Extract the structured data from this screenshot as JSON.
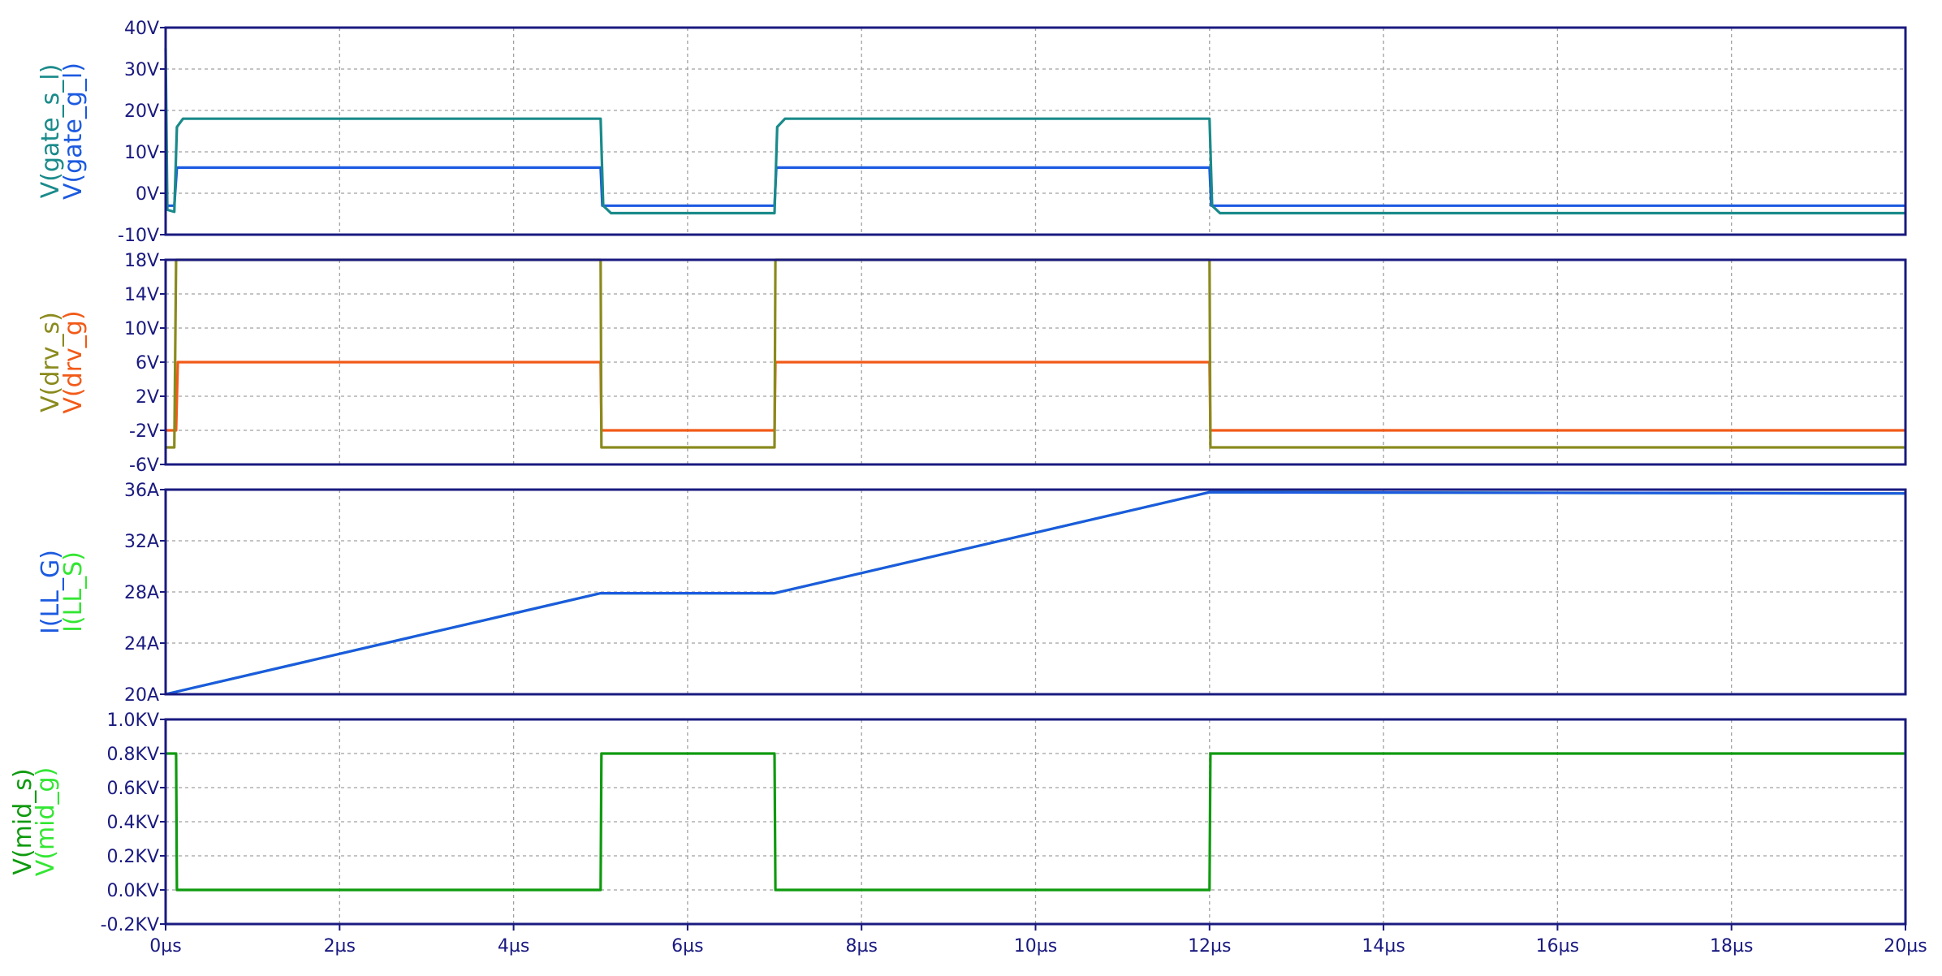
{
  "chart_data": [
    {
      "type": "line",
      "panel": "gate",
      "ylim": [
        -10,
        40
      ],
      "yticks": [
        {
          "value": 40,
          "label": "40V"
        },
        {
          "value": 30,
          "label": "30V"
        },
        {
          "value": 20,
          "label": "20V"
        },
        {
          "value": 10,
          "label": "10V"
        },
        {
          "value": 0,
          "label": "0V"
        },
        {
          "value": -10,
          "label": "-10V"
        }
      ],
      "grid": true,
      "series": [
        {
          "name": "V(gate_s_l)",
          "color": "#1a8a8a",
          "points": [
            [
              0,
              35
            ],
            [
              0.02,
              -4
            ],
            [
              0.1,
              -4.5
            ],
            [
              0.13,
              16
            ],
            [
              0.2,
              18
            ],
            [
              5.0,
              18
            ],
            [
              5.03,
              -3
            ],
            [
              5.12,
              -4.8
            ],
            [
              7.0,
              -4.8
            ],
            [
              7.03,
              16
            ],
            [
              7.12,
              18
            ],
            [
              12.0,
              18
            ],
            [
              12.03,
              -3
            ],
            [
              12.12,
              -4.8
            ],
            [
              20,
              -4.8
            ]
          ]
        },
        {
          "name": "V(gate_g_l)",
          "color": "#1c5ae0",
          "points": [
            [
              0,
              -3
            ],
            [
              0.1,
              -3
            ],
            [
              0.13,
              6.2
            ],
            [
              5.0,
              6.2
            ],
            [
              5.02,
              -3
            ],
            [
              7.0,
              -3
            ],
            [
              7.02,
              6.2
            ],
            [
              12.0,
              6.2
            ],
            [
              12.02,
              -3
            ],
            [
              20,
              -3
            ]
          ]
        }
      ]
    },
    {
      "type": "line",
      "panel": "driver",
      "ylim": [
        -6,
        18
      ],
      "yticks": [
        {
          "value": 18,
          "label": "18V"
        },
        {
          "value": 14,
          "label": "14V"
        },
        {
          "value": 10,
          "label": "10V"
        },
        {
          "value": 6,
          "label": "6V"
        },
        {
          "value": 2,
          "label": "2V"
        },
        {
          "value": -2,
          "label": "-2V"
        },
        {
          "value": -6,
          "label": "-6V"
        }
      ],
      "grid": true,
      "series": [
        {
          "name": "V(drv_s)",
          "color": "#8a8a1e",
          "points": [
            [
              0,
              -4
            ],
            [
              0.1,
              -4
            ],
            [
              0.12,
              18
            ],
            [
              5.0,
              18
            ],
            [
              5.01,
              -4
            ],
            [
              7.0,
              -4
            ],
            [
              7.01,
              18
            ],
            [
              12.0,
              18
            ],
            [
              12.01,
              -4
            ],
            [
              20,
              -4
            ]
          ]
        },
        {
          "name": "V(drv_g)",
          "color": "#f25a18",
          "points": [
            [
              0,
              -2
            ],
            [
              0.12,
              -2
            ],
            [
              0.14,
              6
            ],
            [
              5.0,
              6
            ],
            [
              5.01,
              -2
            ],
            [
              7.0,
              -2
            ],
            [
              7.01,
              6
            ],
            [
              12.0,
              6
            ],
            [
              12.01,
              -2
            ],
            [
              20,
              -2
            ]
          ]
        }
      ]
    },
    {
      "type": "line",
      "panel": "current",
      "ylim": [
        20,
        36
      ],
      "yticks": [
        {
          "value": 36,
          "label": "36A"
        },
        {
          "value": 32,
          "label": "32A"
        },
        {
          "value": 28,
          "label": "28A"
        },
        {
          "value": 24,
          "label": "24A"
        },
        {
          "value": 20,
          "label": "20A"
        }
      ],
      "grid": true,
      "series": [
        {
          "name": "I(LL_G)",
          "color": "#1c5ae0",
          "points": [
            [
              0,
              20
            ],
            [
              5.0,
              27.9
            ],
            [
              7.0,
              27.9
            ],
            [
              12.0,
              35.8
            ],
            [
              20,
              35.7
            ]
          ]
        },
        {
          "name": "I(LL_S)",
          "color": "#33e633",
          "points": [
            [
              0,
              20
            ],
            [
              5.0,
              27.9
            ],
            [
              7.0,
              27.9
            ],
            [
              12.0,
              35.8
            ],
            [
              20,
              35.7
            ]
          ]
        }
      ]
    },
    {
      "type": "line",
      "panel": "mid",
      "ylim": [
        -0.2,
        1.0
      ],
      "yticks": [
        {
          "value": 1.0,
          "label": "1.0KV"
        },
        {
          "value": 0.8,
          "label": "0.8KV"
        },
        {
          "value": 0.6,
          "label": "0.6KV"
        },
        {
          "value": 0.4,
          "label": "0.4KV"
        },
        {
          "value": 0.2,
          "label": "0.2KV"
        },
        {
          "value": 0.0,
          "label": "0.0KV"
        },
        {
          "value": -0.2,
          "label": "-0.2KV"
        }
      ],
      "grid": true,
      "series": [
        {
          "name": "V(mid_s)",
          "color": "#0f9a0f",
          "points": [
            [
              0,
              0.8
            ],
            [
              0.12,
              0.8
            ],
            [
              0.13,
              0.0
            ],
            [
              5.0,
              0.0
            ],
            [
              5.01,
              0.8
            ],
            [
              7.0,
              0.8
            ],
            [
              7.01,
              0.0
            ],
            [
              12.0,
              0.0
            ],
            [
              12.01,
              0.8
            ],
            [
              20,
              0.8
            ]
          ]
        },
        {
          "name": "V(mid_g)",
          "color": "#33e633",
          "points": []
        }
      ]
    }
  ],
  "x_axis": {
    "xlim": [
      0,
      20
    ],
    "ticks": [
      {
        "value": 0,
        "label": "0µs"
      },
      {
        "value": 2,
        "label": "2µs"
      },
      {
        "value": 4,
        "label": "4µs"
      },
      {
        "value": 6,
        "label": "6µs"
      },
      {
        "value": 8,
        "label": "8µs"
      },
      {
        "value": 10,
        "label": "10µs"
      },
      {
        "value": 12,
        "label": "12µs"
      },
      {
        "value": 14,
        "label": "14µs"
      },
      {
        "value": 16,
        "label": "16µs"
      },
      {
        "value": 18,
        "label": "18µs"
      },
      {
        "value": 20,
        "label": "20µs"
      }
    ]
  },
  "colors": {
    "frame": "#1a1a80",
    "grid": "#a0a0a0",
    "tick_text": "#1a1a80"
  }
}
